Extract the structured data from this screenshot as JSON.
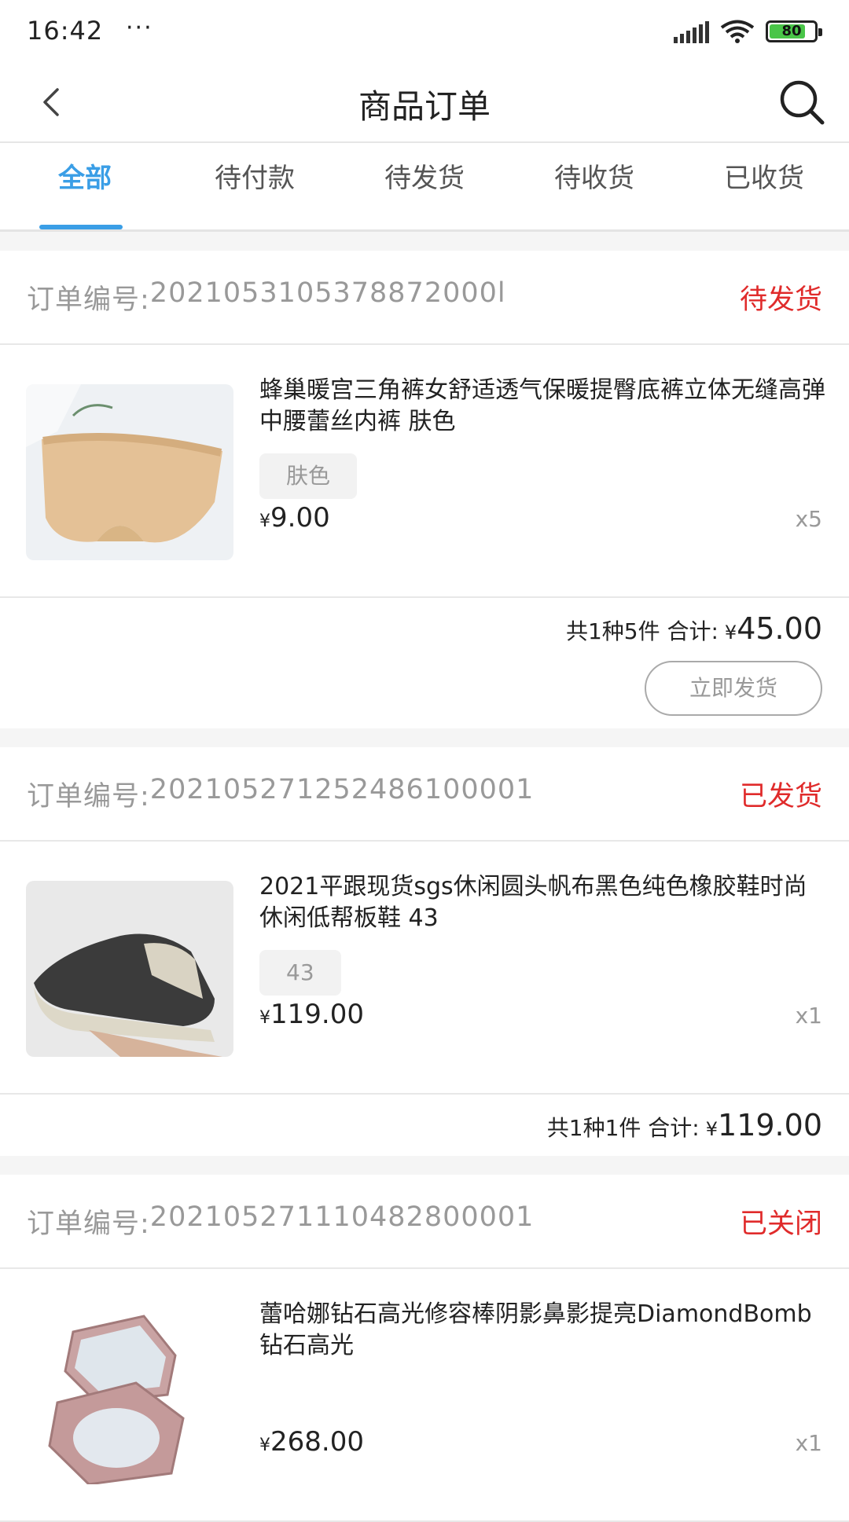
{
  "status_bar": {
    "time": "16:42",
    "dots": "···",
    "battery": "80",
    "battery_level": 0.8,
    "battery_color": "#49c548"
  },
  "header": {
    "title": "商品订单",
    "back_icon": "chevron-left-icon",
    "search_icon": "search-icon"
  },
  "tabs": [
    {
      "label": "全部",
      "active": true
    },
    {
      "label": "待付款"
    },
    {
      "label": "待发货"
    },
    {
      "label": "待收货"
    },
    {
      "label": "已收货"
    }
  ],
  "colors": {
    "accent": "#3a9ee6",
    "status_red": "#e02b2b"
  },
  "orders": [
    {
      "order_label": "订单编号:",
      "order_no": "2021053105378872000l",
      "status": "待发货",
      "item": {
        "title": "蜂巢暖宫三角裤女舒适透气保暖提臀底裤立体无缝高弹中腰蕾丝内裤 肤色",
        "sku": "肤色",
        "currency": "¥",
        "price": "9.00",
        "qty": "x5"
      },
      "summary_text": "共1种5件  合计:",
      "currency": "¥",
      "total": "45.00",
      "action_label": "立即发货"
    },
    {
      "order_label": "订单编号:",
      "order_no": "202105271252486100001",
      "status": "已发货",
      "item": {
        "title": "2021平跟现货sgs休闲圆头帆布黑色纯色橡胶鞋时尚休闲低帮板鞋 43",
        "sku": "43",
        "currency": "¥",
        "price": "119.00",
        "qty": "x1"
      },
      "summary_text": "共1种1件  合计:",
      "currency": "¥",
      "total": "119.00"
    },
    {
      "order_label": "订单编号:",
      "order_no": "202105271110482800001",
      "status": "已关闭",
      "item": {
        "title": "蕾哈娜钻石高光修容棒阴影鼻影提亮DiamondBomb钻石高光",
        "currency": "¥",
        "price": "268.00",
        "qty": "x1"
      }
    }
  ]
}
